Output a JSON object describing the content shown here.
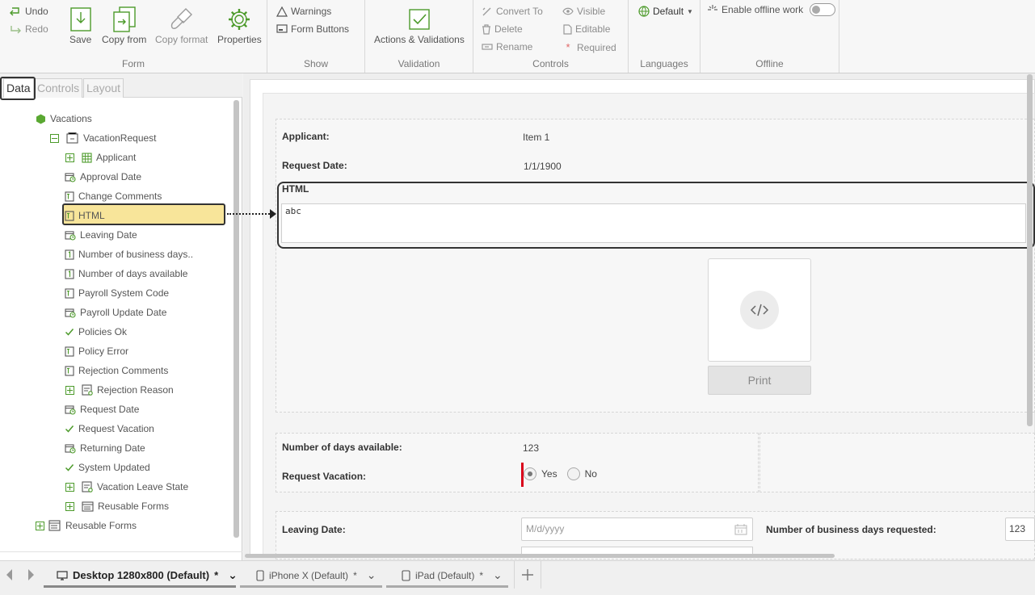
{
  "ribbon": {
    "undo": "Undo",
    "redo": "Redo",
    "save": "Save",
    "copy_from": "Copy from",
    "copy_format": "Copy format",
    "properties": "Properties",
    "group_form": "Form",
    "warnings": "Warnings",
    "form_buttons": "Form Buttons",
    "group_show": "Show",
    "actions_validations": "Actions & Validations",
    "group_validation": "Validation",
    "convert_to": "Convert To",
    "delete": "Delete",
    "rename": "Rename",
    "visible": "Visible",
    "editable": "Editable",
    "required": "Required",
    "group_controls": "Controls",
    "language": "Default",
    "group_languages": "Languages",
    "offline_label": "Enable offline work",
    "group_offline": "Offline"
  },
  "panel_tabs": [
    "Data",
    "Controls",
    "Layout"
  ],
  "tree": {
    "root": "Vacations",
    "entity": "VacationRequest",
    "items": [
      {
        "label": "Applicant",
        "icon": "table-icon",
        "expandable": true
      },
      {
        "label": "Approval Date",
        "icon": "date-icon"
      },
      {
        "label": "Change Comments",
        "icon": "text-icon"
      },
      {
        "label": "HTML",
        "icon": "text-icon"
      },
      {
        "label": "Leaving Date",
        "icon": "date-icon"
      },
      {
        "label": "Number of business days..",
        "icon": "number-icon"
      },
      {
        "label": "Number of days available",
        "icon": "number-icon"
      },
      {
        "label": "Payroll System Code",
        "icon": "text-icon"
      },
      {
        "label": "Payroll Update Date",
        "icon": "date-icon"
      },
      {
        "label": "Policies Ok",
        "icon": "check-icon"
      },
      {
        "label": "Policy Error",
        "icon": "text-icon"
      },
      {
        "label": "Rejection Comments",
        "icon": "text-icon"
      },
      {
        "label": "Rejection Reason",
        "icon": "entity-icon",
        "expandable": true
      },
      {
        "label": "Request Date",
        "icon": "date-icon"
      },
      {
        "label": "Request Vacation",
        "icon": "check-icon"
      },
      {
        "label": "Returning Date",
        "icon": "date-icon"
      },
      {
        "label": "System Updated",
        "icon": "check-icon"
      },
      {
        "label": "Vacation Leave State",
        "icon": "entity-icon",
        "expandable": true
      },
      {
        "label": "Reusable Forms",
        "icon": "forms-icon",
        "expandable": true
      }
    ],
    "root_reusable": "Reusable Forms"
  },
  "form": {
    "applicant_label": "Applicant:",
    "applicant_value": "Item 1",
    "request_date_label": "Request Date:",
    "request_date_value": "1/1/1900",
    "html_label": "HTML",
    "html_value": "abc",
    "print_label": "Print",
    "days_available_label": "Number of days available:",
    "days_available_value": "123",
    "request_vacation_label": "Request Vacation:",
    "yes": "Yes",
    "no": "No",
    "leaving_date_label": "Leaving Date:",
    "leaving_date_placeholder": "M/d/yyyy",
    "business_days_label": "Number of business days requested:",
    "business_days_value": "123"
  },
  "devices": [
    {
      "label": "Desktop 1280x800 (Default)",
      "modified": "*"
    },
    {
      "label": "iPhone X (Default)",
      "modified": "*"
    },
    {
      "label": "iPad (Default)",
      "modified": "*"
    }
  ],
  "colors": {
    "accent_green": "#4c9a2a",
    "selection": "#f8e59a",
    "required_red": "#d9001b"
  }
}
